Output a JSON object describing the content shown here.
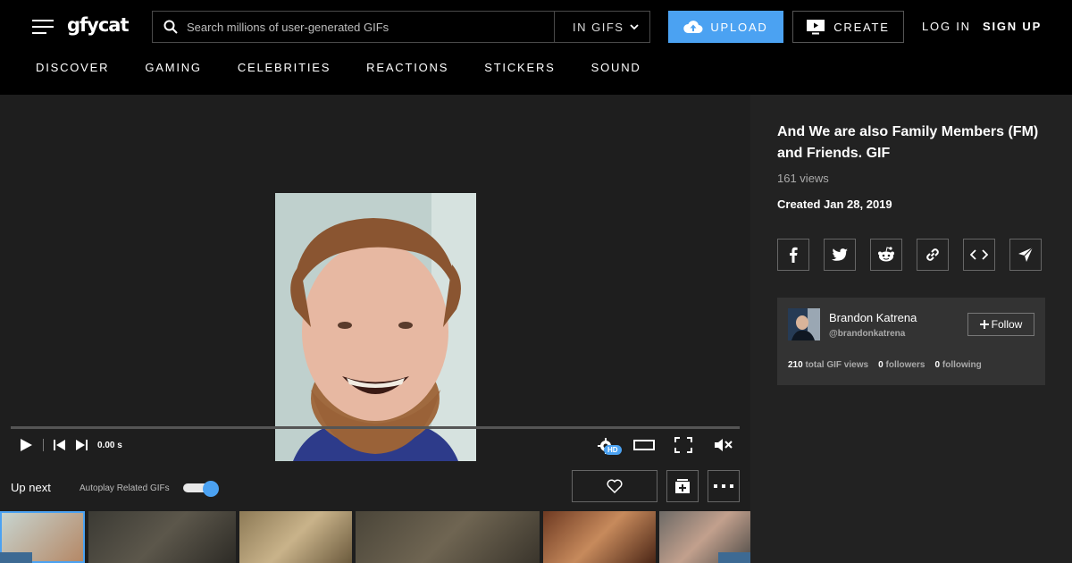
{
  "header": {
    "logo_text": "gfycat",
    "search": {
      "placeholder": "Search millions of user-generated GIFs",
      "scope": "IN GIFS"
    },
    "upload_label": "UPLOAD",
    "create_label": "CREATE",
    "login_label": "LOG IN",
    "signup_label": "SIGN UP",
    "accent_color": "#4ba2f2"
  },
  "nav": {
    "items": [
      {
        "label": "DISCOVER"
      },
      {
        "label": "GAMING"
      },
      {
        "label": "CELEBRITIES"
      },
      {
        "label": "REACTIONS"
      },
      {
        "label": "STICKERS"
      },
      {
        "label": "SOUND"
      }
    ]
  },
  "player": {
    "time": "0.00 s",
    "hd_label": "HD",
    "progress": 0
  },
  "upnext": {
    "label": "Up next",
    "autoplay_label": "Autoplay Related GIFs",
    "autoplay_on": true
  },
  "gif": {
    "title": "And We are also Family Members (FM) and Friends. GIF",
    "views": "161 views",
    "created": "Created Jan 28, 2019"
  },
  "share": {
    "icons": [
      "facebook-icon",
      "twitter-icon",
      "reddit-icon",
      "link-icon",
      "embed-code-icon",
      "send-icon"
    ]
  },
  "user": {
    "name": "Brandon Katrena",
    "handle": "@brandonkatrena",
    "follow_label": "Follow",
    "total_views": "210",
    "total_views_label": "total GIF views",
    "followers": "0",
    "followers_label": "followers",
    "following": "0",
    "following_label": "following"
  }
}
